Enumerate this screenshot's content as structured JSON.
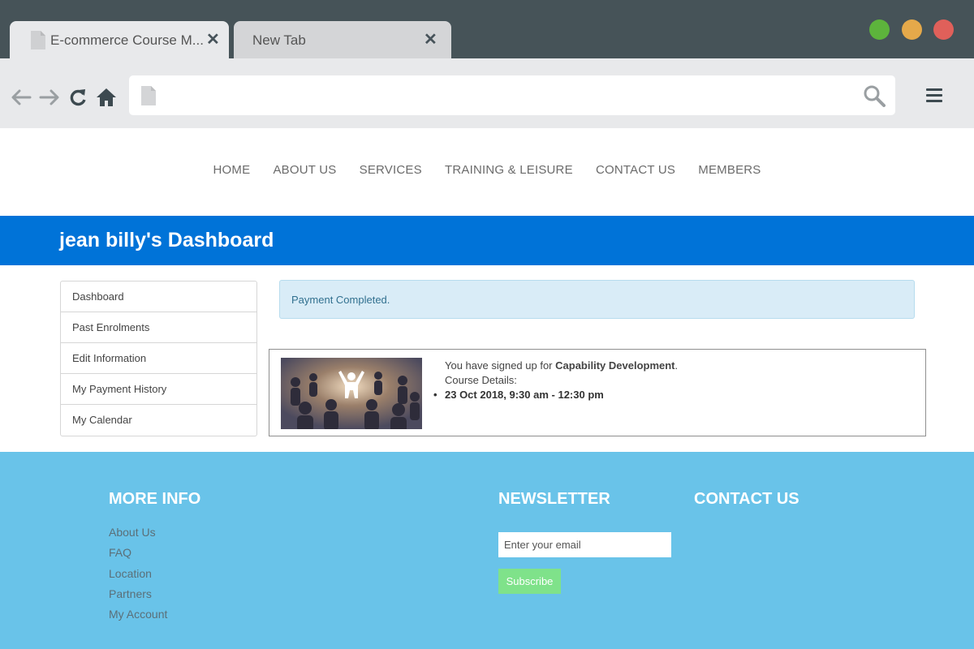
{
  "browser": {
    "tabs": [
      {
        "title": "E-commerce Course M...",
        "close": "✕",
        "active": true
      },
      {
        "title": "New Tab",
        "close": "✕",
        "active": false
      }
    ],
    "window_controls": {
      "minimize": "#5db43c",
      "maximize": "#e5a94a",
      "close": "#e0605a"
    },
    "address_bar": {
      "value": ""
    }
  },
  "site": {
    "nav": [
      "HOME",
      "ABOUT US",
      "SERVICES",
      "TRAINING & LEISURE",
      "CONTACT US",
      "MEMBERS"
    ],
    "dashboard_title": "jean billy's Dashboard",
    "sidebar": [
      "Dashboard",
      "Past Enrolments",
      "Edit Information",
      "My Payment History",
      "My Calendar"
    ],
    "alert": "Payment Completed.",
    "enrolment": {
      "prefix": "You have signed up for ",
      "course": "Capability Development",
      "suffix": ".",
      "details_label": "Course Details:",
      "sessions": [
        "23 Oct 2018, 9:30 am - 12:30 pm"
      ]
    },
    "footer": {
      "more_info_title": "MORE INFO",
      "links": [
        "About Us",
        "FAQ",
        "Location",
        "Partners",
        "My Account"
      ],
      "newsletter_title": "NEWSLETTER",
      "email_placeholder": "Enter your email",
      "subscribe_label": "Subscribe",
      "contact_title": "CONTACT US"
    }
  },
  "colors": {
    "banner": "#0073d8",
    "footer": "#69c3e9",
    "subscribe": "#7fe28a",
    "alert_bg": "#d9ecf7"
  }
}
